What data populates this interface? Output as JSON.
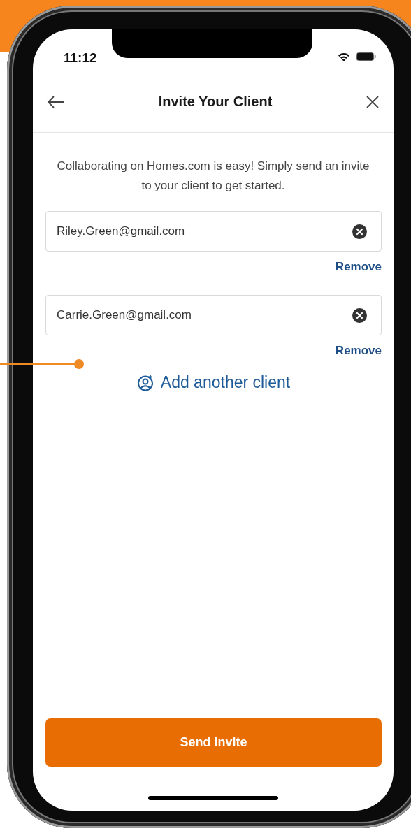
{
  "status_bar": {
    "time": "11:12"
  },
  "header": {
    "title": "Invite Your Client"
  },
  "description": "Collaborating on Homes.com is easy! Simply send an invite to your client to get started.",
  "clients": [
    {
      "email": "Riley.Green@gmail.com",
      "remove_label": "Remove"
    },
    {
      "email": "Carrie.Green@gmail.com",
      "remove_label": "Remove"
    }
  ],
  "add_client": {
    "label": "Add another client"
  },
  "primary_button": {
    "label": "Send Invite"
  }
}
